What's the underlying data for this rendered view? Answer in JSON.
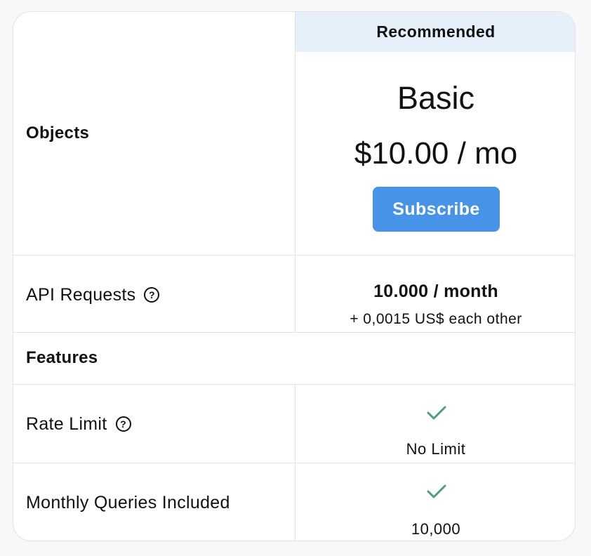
{
  "header": {
    "recommended_label": "Recommended"
  },
  "rows": {
    "objects_label": "Objects",
    "api_requests_label": "API Requests",
    "features_label": "Features",
    "rate_limit_label": "Rate Limit",
    "monthly_queries_label": "Monthly Queries Included"
  },
  "plan": {
    "name": "Basic",
    "price": "$10.00 / mo",
    "subscribe_label": "Subscribe",
    "api_requests_value": "10.000 / month",
    "api_requests_extra": "+ 0,0015 US$ each other",
    "rate_limit_value": "No Limit",
    "monthly_queries_value": "10,000"
  },
  "icons": {
    "help": "question-circle-icon",
    "check": "check-icon",
    "help_glyph": "?"
  },
  "colors": {
    "accent": "#4693e8",
    "recommended_bg": "#e5f0fb",
    "check": "#4a9e86",
    "border": "#e3e3e3"
  }
}
